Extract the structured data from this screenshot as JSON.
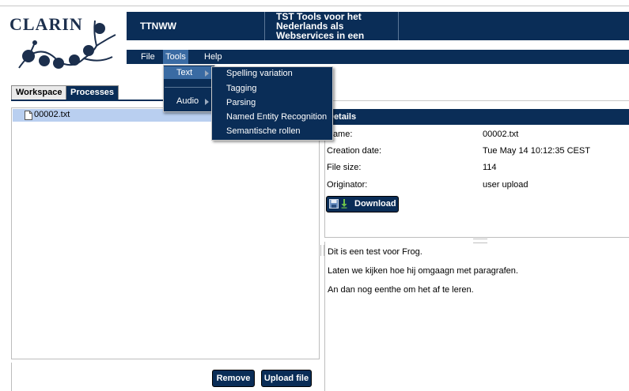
{
  "logo": {
    "text": "CLARIN"
  },
  "header": {
    "app_name": "TTNWW",
    "title": "TST Tools voor het Nederlands als Webservices in een"
  },
  "menubar": {
    "file": "File",
    "tools": "Tools",
    "help": "Help"
  },
  "tools_menu": {
    "items": [
      "Text",
      "Audio"
    ],
    "text_submenu": [
      "Spelling variation",
      "Tagging",
      "Parsing",
      "Named Entity Recognition",
      "Semantische rollen"
    ]
  },
  "tabs": {
    "workspace": "Workspace",
    "processes": "Processes"
  },
  "workspace": {
    "files": [
      "00002.txt"
    ]
  },
  "buttons": {
    "remove": "Remove",
    "upload": "Upload file",
    "download": "Download"
  },
  "details": {
    "header": "Details",
    "rows": [
      {
        "label": "Name:",
        "value": "00002.txt"
      },
      {
        "label": "Creation date:",
        "value": "Tue May 14 10:12:35 CEST"
      },
      {
        "label": "File size:",
        "value": "114"
      },
      {
        "label": "Originator:",
        "value": "user upload"
      }
    ]
  },
  "content": {
    "lines": [
      "Dit is een test voor Frog.",
      "Laten we kijken hoe hij omgaagn met paragrafen.",
      "An dan nog eenthe om het af te leren."
    ]
  },
  "colors": {
    "navy": "#0a2d57",
    "highlight": "#3a6ba3",
    "selected_row": "#b9cff0"
  }
}
